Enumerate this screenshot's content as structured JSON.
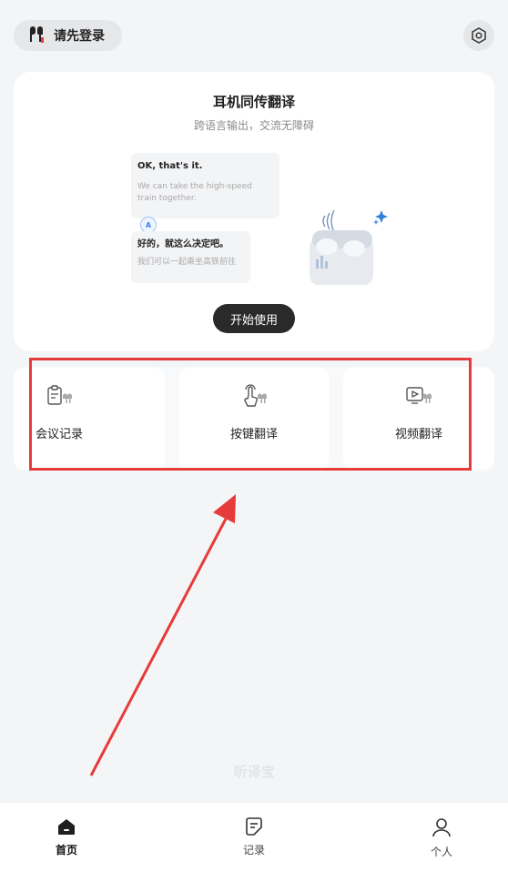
{
  "header": {
    "login_label": "请先登录",
    "login_icon": "earbuds-icon",
    "settings_icon": "settings-icon"
  },
  "hero": {
    "title": "耳机同传翻译",
    "subtitle": "跨语言输出，交流无障碍",
    "bubble_en": {
      "text": "OK, that's it.",
      "translation": "We can take the high-speed train together."
    },
    "bubble_zh": {
      "text": "好的，就这么决定吧。",
      "translation": "我们可以一起乘坐高铁前往"
    },
    "translate_badge": "A",
    "start_button": "开始使用"
  },
  "features": [
    {
      "label": "会议记录",
      "icon": "meeting-record-icon"
    },
    {
      "label": "按键翻译",
      "icon": "tap-translate-icon"
    },
    {
      "label": "视频翻译",
      "icon": "video-translate-icon"
    }
  ],
  "watermark": "听译宝",
  "tabbar": {
    "items": [
      {
        "label": "首页",
        "icon": "home-icon",
        "active": true
      },
      {
        "label": "记录",
        "icon": "records-icon",
        "active": false
      },
      {
        "label": "个人",
        "icon": "profile-icon",
        "active": false
      }
    ]
  },
  "colors": {
    "background": "#f4f5f7",
    "primary_button": "#2a2a2a",
    "annotation_red": "#e53b3b",
    "accent_blue": "#3b82f6"
  }
}
